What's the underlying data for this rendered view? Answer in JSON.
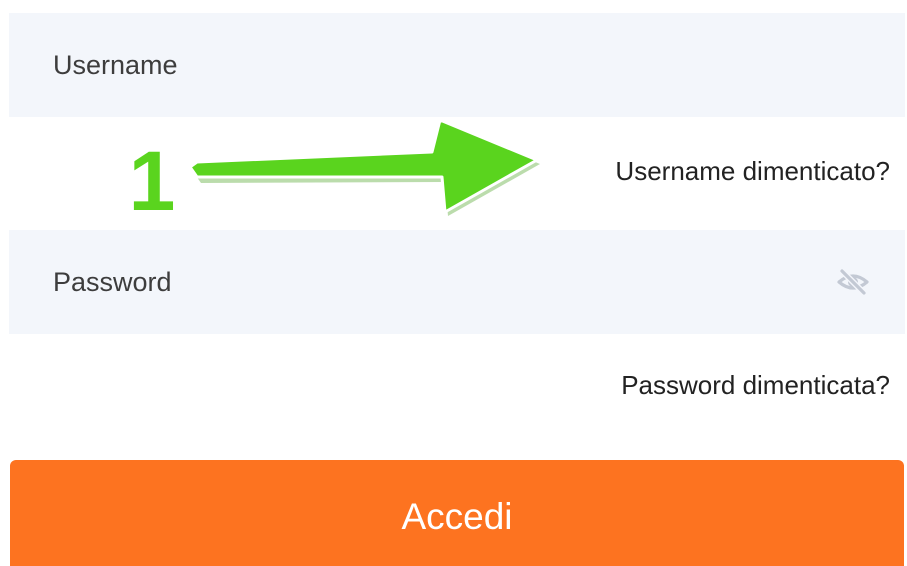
{
  "form": {
    "username": {
      "placeholder": "Username",
      "value": ""
    },
    "username_forgot_link": "Username dimenticato?",
    "password": {
      "placeholder": "Password",
      "value": "",
      "toggle_icon": "eye-slash-icon"
    },
    "password_forgot_link": "Password dimenticata?",
    "submit_label": "Accedi"
  },
  "annotation": {
    "step_number": "1",
    "arrow_color": "#5ad41e",
    "step_outline_color": "#ffffff"
  },
  "colors": {
    "accent": "#fd7320",
    "field_background": "#f3f6fb",
    "icon_muted": "#c3c9d4"
  }
}
